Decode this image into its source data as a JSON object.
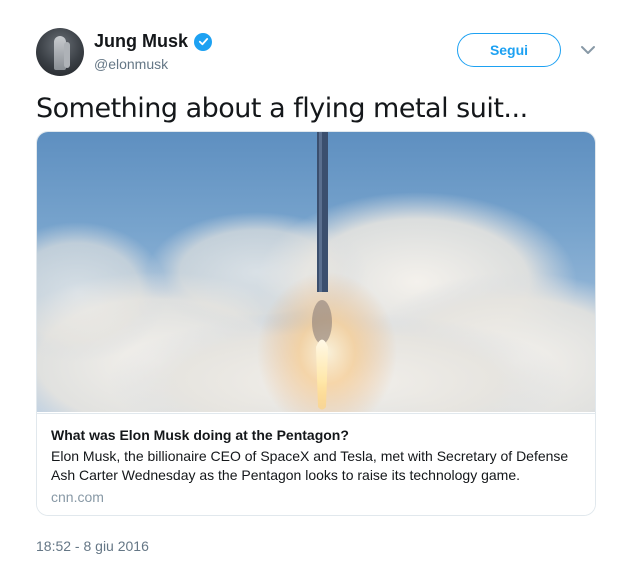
{
  "author": {
    "display_name": "Jung Musk",
    "handle": "@elonmusk",
    "verified": true,
    "avatar_icon": "avatar-photo"
  },
  "follow_button": {
    "label": "Segui"
  },
  "menu_icon": "chevron-down-icon",
  "tweet": {
    "text": "Something about a flying metal suit..."
  },
  "card": {
    "image_icon": "rocket-launch-photo",
    "title": "What was Elon Musk doing at the Pentagon?",
    "description": "Elon Musk, the billionaire CEO of SpaceX and Tesla, met with Secretary of Defense Ash Carter Wednesday as the Pentagon looks to raise its technology game.",
    "domain": "cnn.com"
  },
  "timestamp": "18:52 - 8 giu 2016",
  "colors": {
    "accent": "#1da1f2",
    "text": "#14171a",
    "secondary": "#657786",
    "border": "#e1e8ed"
  }
}
